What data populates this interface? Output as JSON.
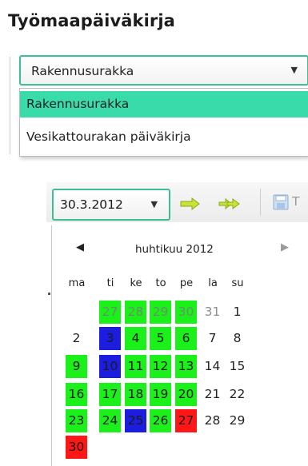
{
  "header": {
    "title": "Työmaapäiväkirja"
  },
  "diary_select": {
    "selected": "Rakennusurakka",
    "options": [
      "Rakennusurakka",
      "Vesikattourakan päiväkirja"
    ],
    "highlighted_index": 0
  },
  "date_picker": {
    "value": "30.3.2012",
    "toolbar_text": "T",
    "calendar": {
      "month_label": "huhtikuu 2012",
      "weekdays": [
        "ma",
        "ti",
        "ke",
        "to",
        "pe",
        "la",
        "su"
      ],
      "weeks": [
        [
          null,
          {
            "d": "27",
            "s": "green-dim"
          },
          {
            "d": "28",
            "s": "green-dim"
          },
          {
            "d": "29",
            "s": "green-dim"
          },
          {
            "d": "30",
            "s": "green-dim"
          },
          {
            "d": "31",
            "s": "plain-dim"
          },
          {
            "d": "1",
            "s": "plain"
          }
        ],
        [
          {
            "d": "2",
            "s": "plain"
          },
          {
            "d": "3",
            "s": "blue"
          },
          {
            "d": "4",
            "s": "green"
          },
          {
            "d": "5",
            "s": "green"
          },
          {
            "d": "6",
            "s": "green"
          },
          {
            "d": "7",
            "s": "plain"
          },
          {
            "d": "8",
            "s": "plain"
          }
        ],
        [
          {
            "d": "9",
            "s": "green"
          },
          {
            "d": "10",
            "s": "blue"
          },
          {
            "d": "11",
            "s": "green"
          },
          {
            "d": "12",
            "s": "green"
          },
          {
            "d": "13",
            "s": "green"
          },
          {
            "d": "14",
            "s": "plain"
          },
          {
            "d": "15",
            "s": "plain"
          }
        ],
        [
          {
            "d": "16",
            "s": "green"
          },
          {
            "d": "17",
            "s": "green"
          },
          {
            "d": "18",
            "s": "green"
          },
          {
            "d": "19",
            "s": "green"
          },
          {
            "d": "20",
            "s": "green"
          },
          {
            "d": "21",
            "s": "plain"
          },
          {
            "d": "22",
            "s": "plain"
          }
        ],
        [
          {
            "d": "23",
            "s": "green"
          },
          {
            "d": "24",
            "s": "green"
          },
          {
            "d": "25",
            "s": "blue"
          },
          {
            "d": "26",
            "s": "green"
          },
          {
            "d": "27",
            "s": "red"
          },
          {
            "d": "28",
            "s": "plain"
          },
          {
            "d": "29",
            "s": "plain"
          }
        ],
        [
          {
            "d": "30",
            "s": "red"
          },
          null,
          null,
          null,
          null,
          null,
          null
        ]
      ]
    }
  },
  "icons": {
    "prev": "prev-month-icon",
    "next": "next-month-icon",
    "forward": "arrow-right-icon",
    "forward_fast": "double-arrow-right-icon",
    "save": "save-icon"
  },
  "colors": {
    "accent_border": "#3fbf8f",
    "list_highlight": "#38dba9",
    "day_entry": "#1bf01b",
    "day_blue": "#1d1de0",
    "day_red": "#ff1717"
  }
}
